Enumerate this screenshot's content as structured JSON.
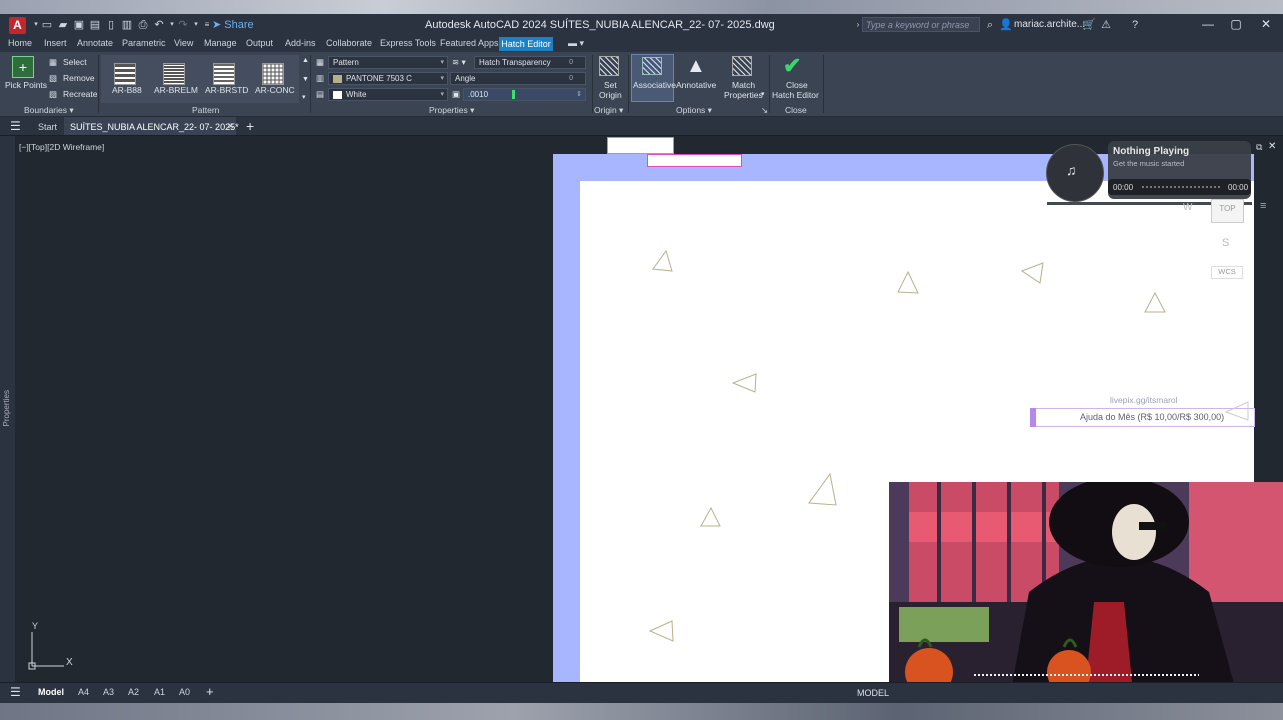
{
  "titlebar": {
    "app_letter": "A",
    "share": "Share",
    "title": "Autodesk AutoCAD 2024   SUÍTES_NUBIA  ALENCAR_22- 07- 2025.dwg",
    "search_placeholder": "Type a keyword or phrase",
    "user": "mariac.archite..."
  },
  "ribbon_tabs": [
    "Home",
    "Insert",
    "Annotate",
    "Parametric",
    "View",
    "Manage",
    "Output",
    "Add-ins",
    "Collaborate",
    "Express Tools",
    "Featured Apps",
    "Hatch Editor"
  ],
  "ribbon": {
    "boundaries": {
      "pick_points": "Pick Points",
      "select": "Select",
      "remove": "Remove",
      "recreate": "Recreate",
      "footer": "Boundaries"
    },
    "pattern": {
      "items": [
        "AR-B88",
        "AR-BRELM",
        "AR-BRSTD",
        "AR-CONC"
      ],
      "footer": "Pattern"
    },
    "properties": {
      "type": "Pattern",
      "color": "PANTONE 7503 C",
      "bg_color": "White",
      "transparency_label": "Hatch Transparency",
      "transparency_value": "0",
      "angle_label": "Angle",
      "angle_value": "0",
      "scale_value": ".0010",
      "footer": "Properties"
    },
    "origin": {
      "set_origin_1": "Set",
      "set_origin_2": "Origin",
      "footer": "Origin"
    },
    "options": {
      "associative": "Associative",
      "annotative": "Annotative",
      "match_1": "Match",
      "match_2": "Properties",
      "footer": "Options"
    },
    "close": {
      "label_1": "Close",
      "label_2": "Hatch Editor",
      "footer": "Close"
    }
  },
  "file_tabs": {
    "start": "Start",
    "active": "SUÍTES_NUBIA  ALENCAR_22- 07- 2025*"
  },
  "viewport": {
    "label": "[−][Top][2D Wireframe]",
    "properties": "Properties"
  },
  "music": {
    "title": "Nothing Playing",
    "subtitle": "Get the music started",
    "time_start": "00:00",
    "time_end": "00:00"
  },
  "viewcube": {
    "top": "TOP",
    "wcs": "WCS"
  },
  "livepix": {
    "url": "livepix.gg/itsmarol",
    "goal": "Ajuda do Mês (R$ 10,00/R$ 300,00)"
  },
  "layout_tabs": [
    "Model",
    "A4",
    "A3",
    "A2",
    "A1",
    "A0"
  ],
  "status": {
    "model": "MODEL"
  },
  "ucs": {
    "x": "X",
    "y": "Y"
  },
  "colors": {
    "accent": "#1b82c6",
    "sheet_border": "#a8b6ff",
    "hatch_color": "#b9b08a"
  }
}
